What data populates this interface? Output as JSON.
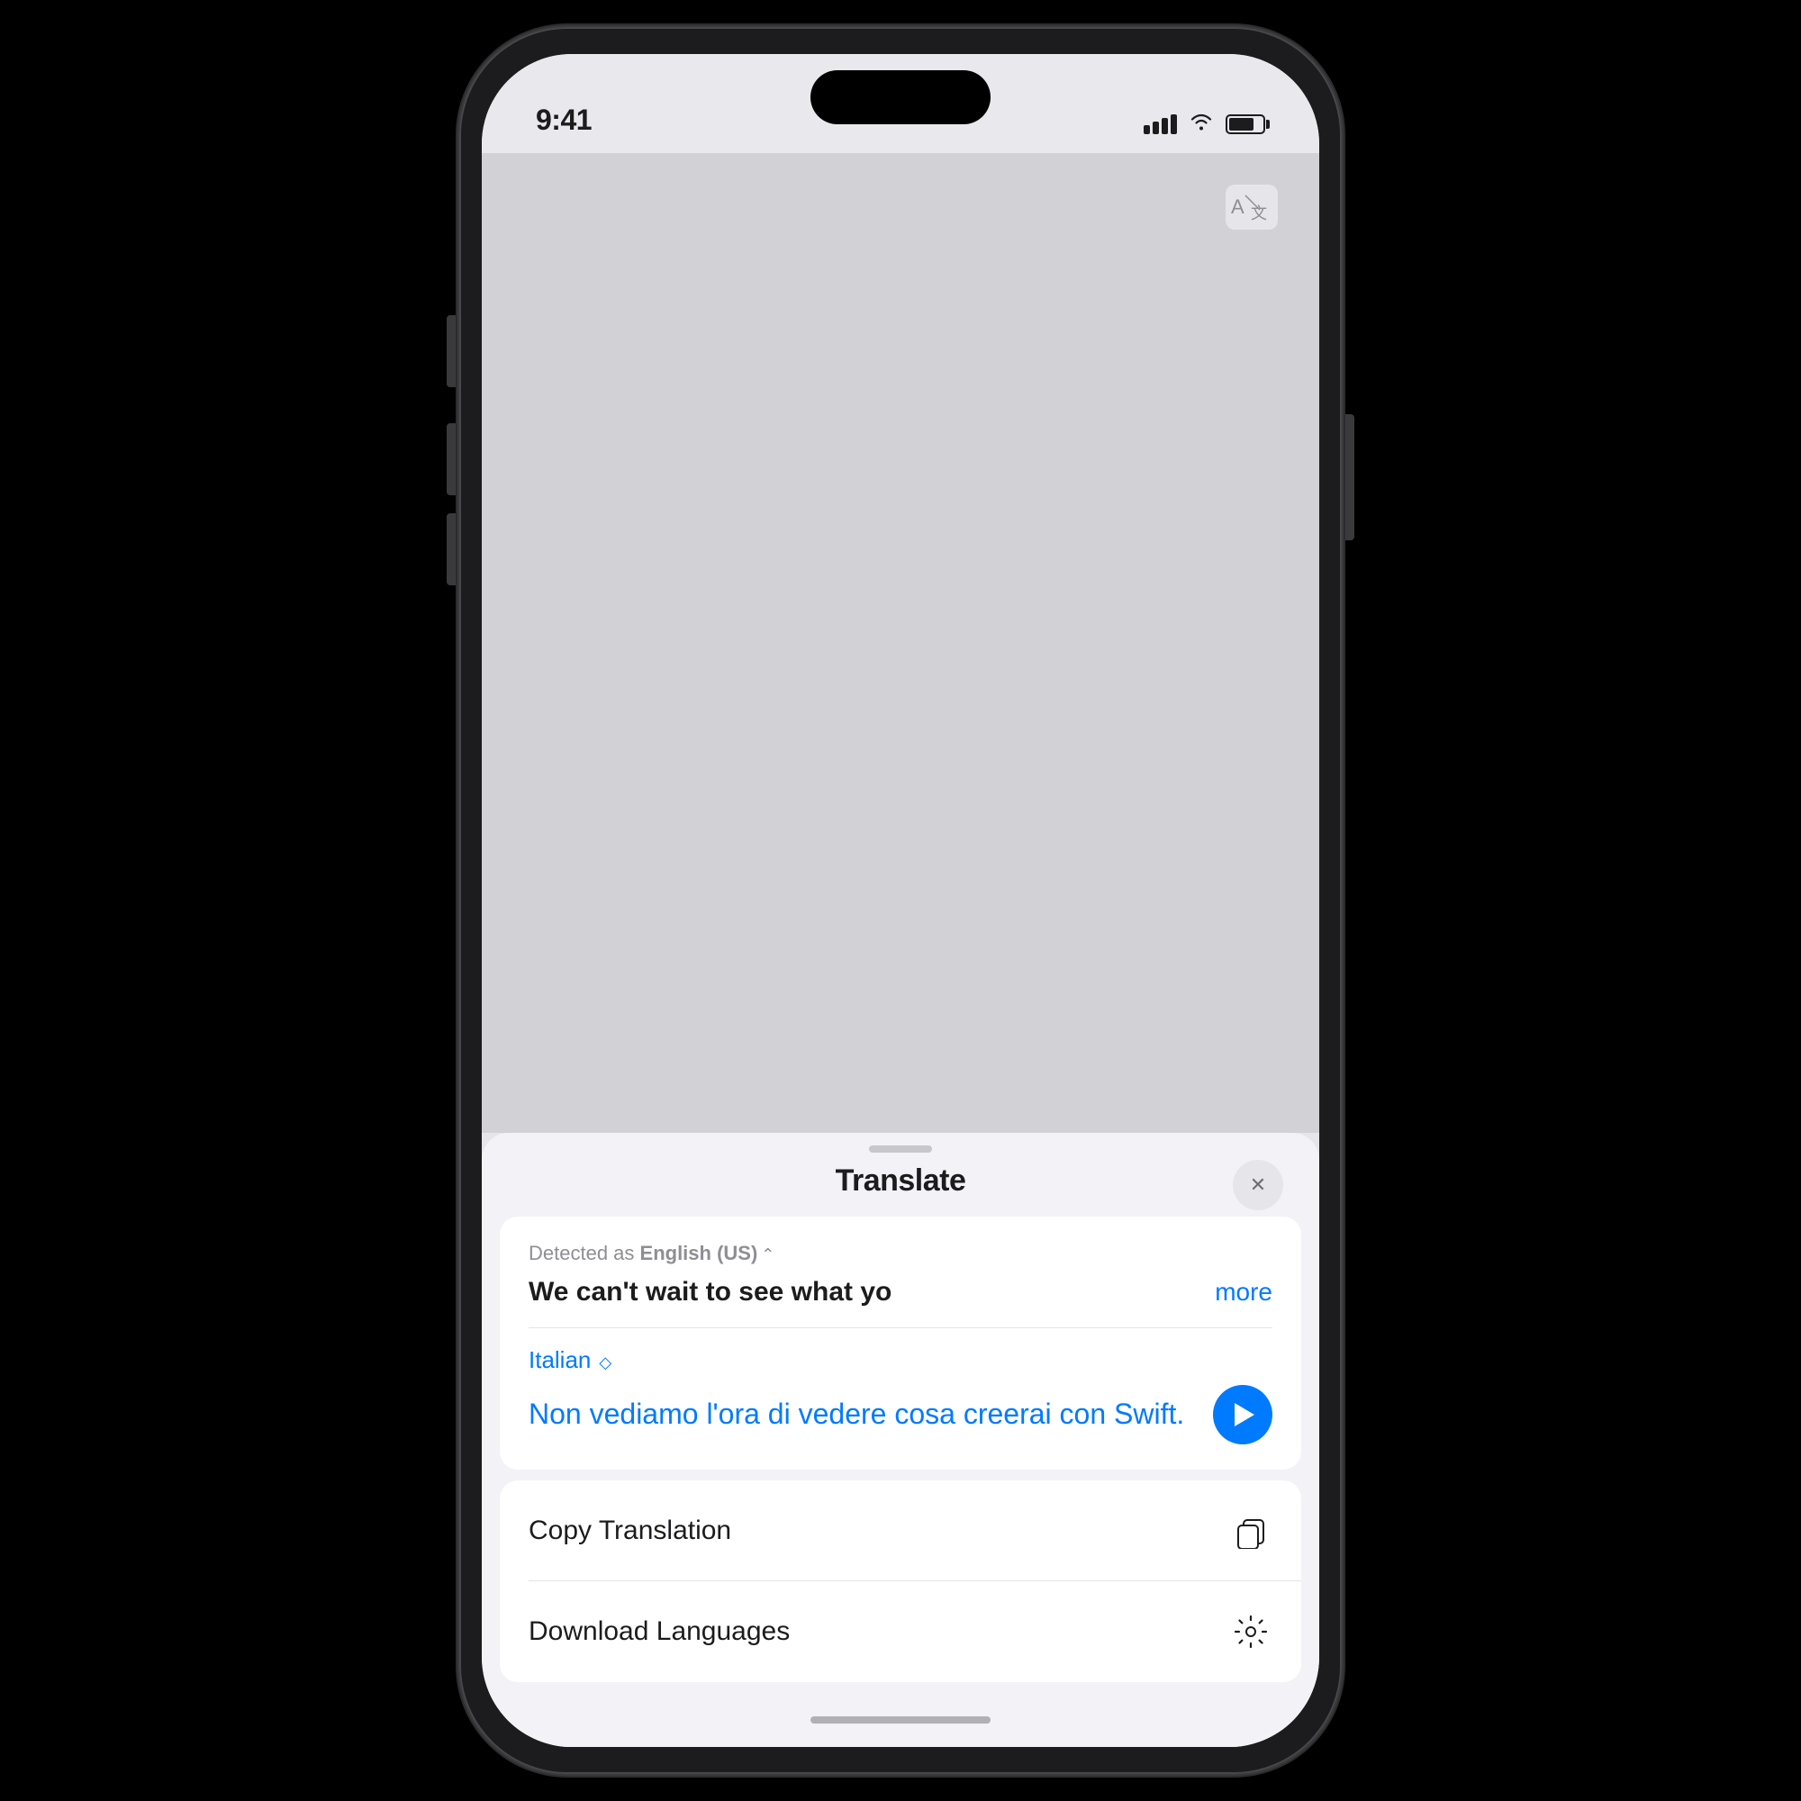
{
  "status_bar": {
    "time": "9:41",
    "signal_label": "signal",
    "wifi_label": "wifi",
    "battery_label": "battery"
  },
  "translate_icon": {
    "label": "translate-app-icon"
  },
  "bottom_sheet": {
    "handle_label": "sheet-handle",
    "title": "Translate",
    "close_label": "✕"
  },
  "translation_card": {
    "detected_prefix": "Detected as ",
    "detected_lang": "English (US)",
    "source_text": "We can't wait to see what yo",
    "more_label": "more",
    "target_lang": "Italian",
    "translated_text": "Non vediamo l'ora di vedere cosa creerai con Swift.",
    "play_label": "play"
  },
  "actions": [
    {
      "label": "Copy Translation",
      "icon": "copy-icon"
    },
    {
      "label": "Download Languages",
      "icon": "settings-icon"
    }
  ]
}
